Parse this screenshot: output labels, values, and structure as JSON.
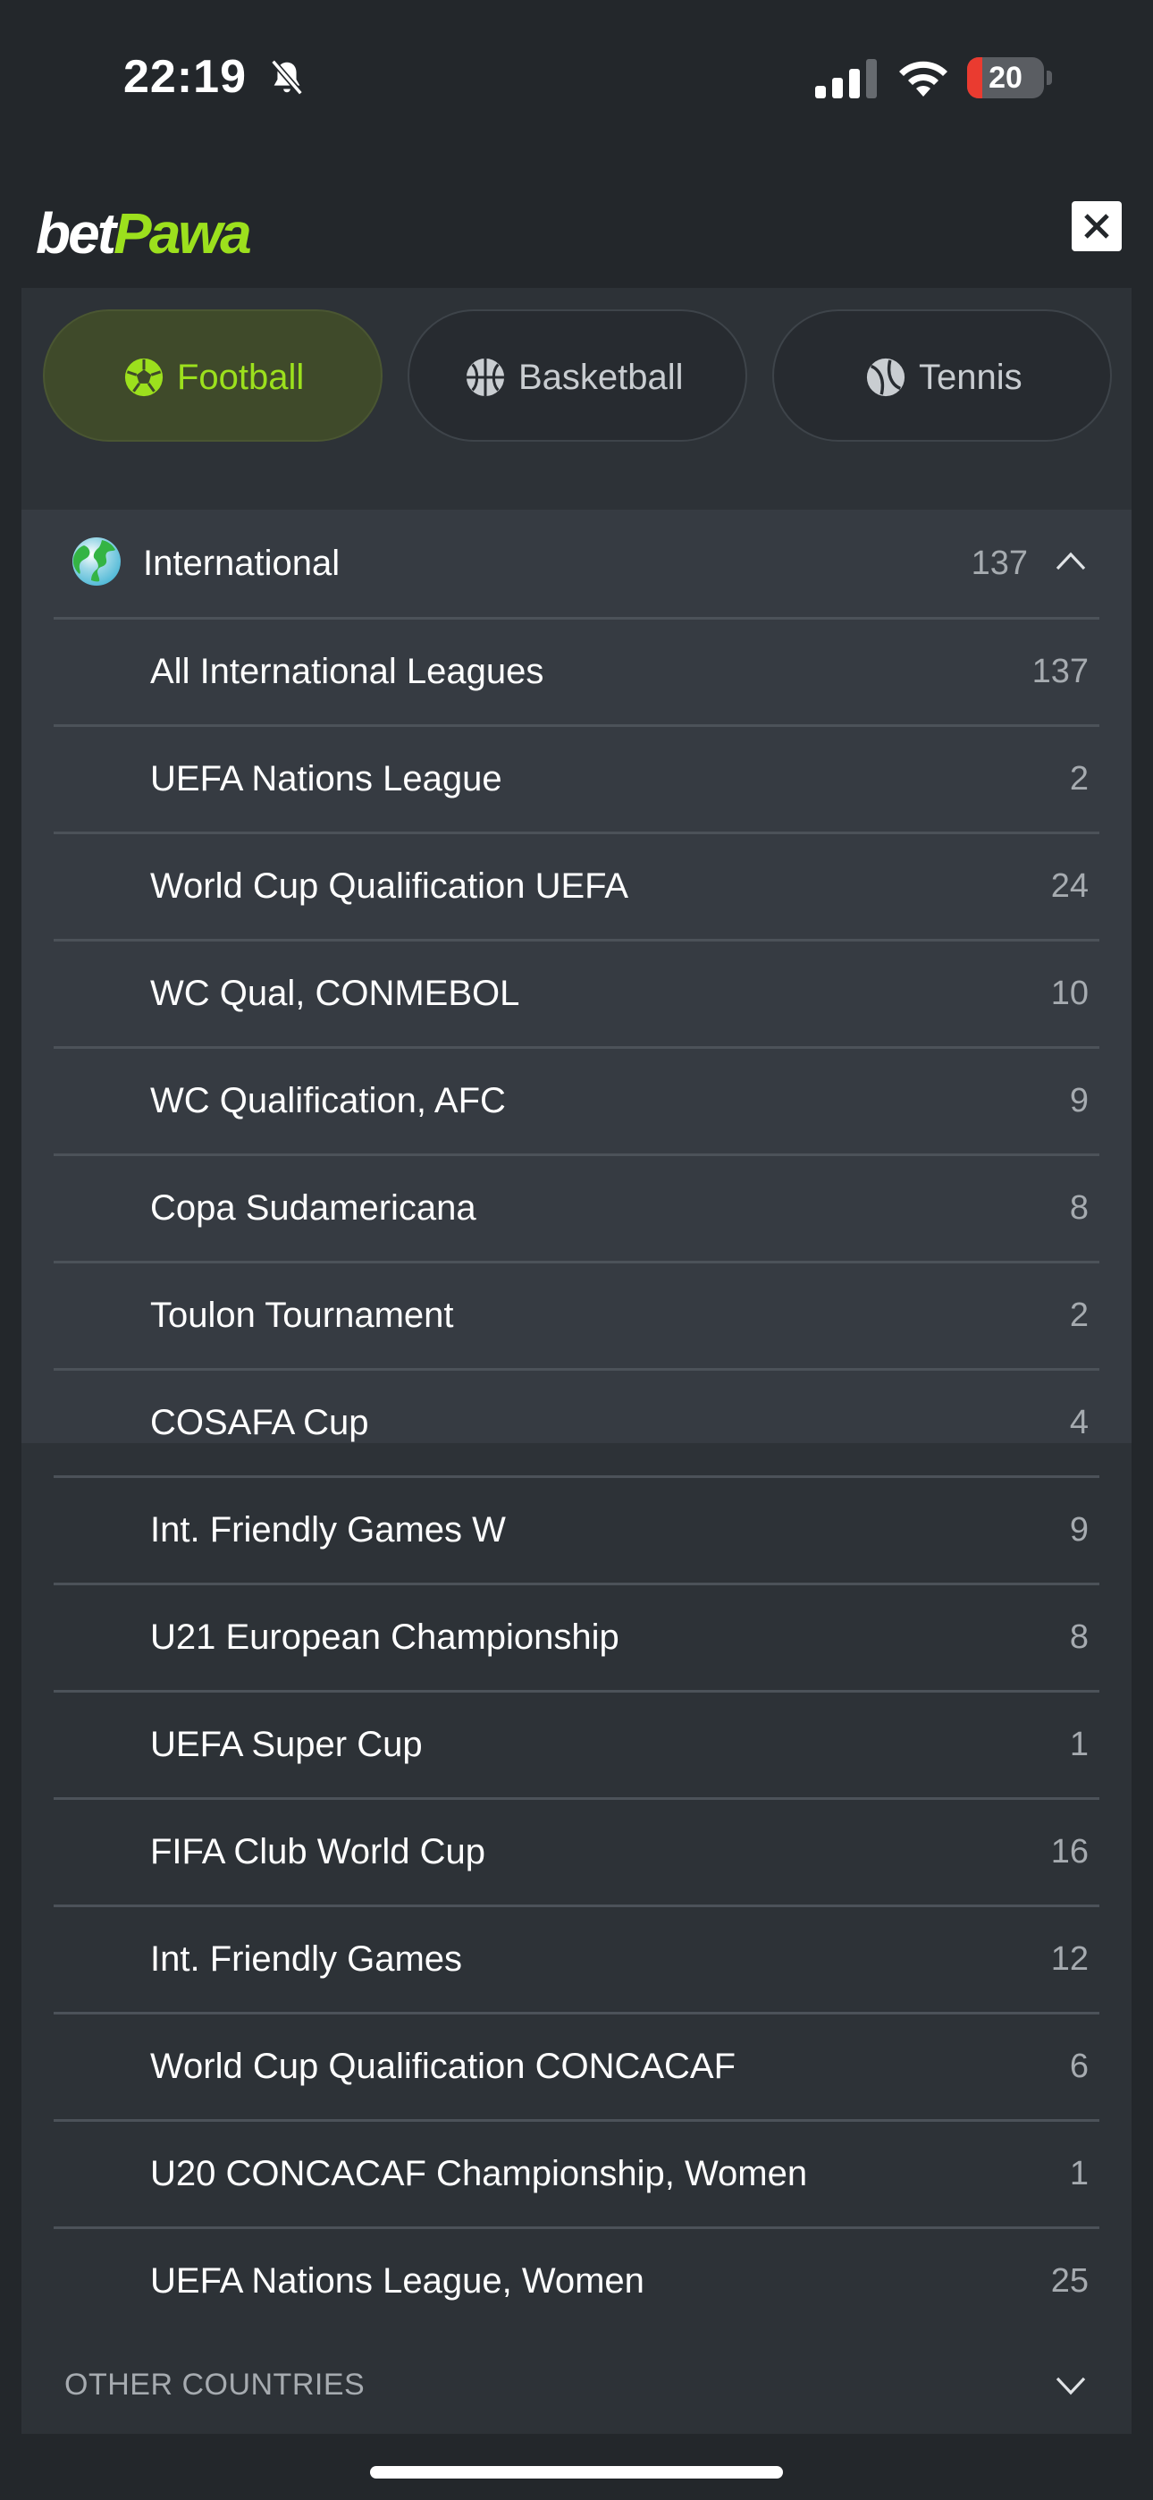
{
  "status_bar": {
    "time": "22:19",
    "battery_level": "20",
    "battery_fraction": 0.2,
    "icons": [
      "bell-slash-icon",
      "cellular-signal-icon",
      "wifi-icon",
      "battery-icon"
    ]
  },
  "header": {
    "logo_part1": "bet",
    "logo_part2": "Pawa",
    "close_icon": "close-icon"
  },
  "colors": {
    "brand_green": "#9ce01d",
    "background": "#23272b",
    "panel": "#2d3237",
    "group": "#363b42",
    "battery_red": "#ea3b30"
  },
  "sport_tabs": [
    {
      "label": "Football",
      "icon": "football-icon",
      "active": true
    },
    {
      "label": "Basketball",
      "icon": "basketball-icon",
      "active": false
    },
    {
      "label": "Tennis",
      "icon": "tennis-icon",
      "active": false
    }
  ],
  "group": {
    "title": "International",
    "count": "137",
    "icon": "globe-icon",
    "expanded": true,
    "leagues": [
      {
        "name": "All International Leagues",
        "count": "137"
      },
      {
        "name": "UEFA Nations League",
        "count": "2"
      },
      {
        "name": "World Cup Qualification UEFA",
        "count": "24"
      },
      {
        "name": "WC Qual, CONMEBOL",
        "count": "10"
      },
      {
        "name": "WC Qualification, AFC",
        "count": "9"
      },
      {
        "name": "Copa Sudamericana",
        "count": "8"
      },
      {
        "name": "Toulon Tournament",
        "count": "2"
      },
      {
        "name": "COSAFA Cup",
        "count": "4"
      },
      {
        "name": "Int. Friendly Games W",
        "count": "9"
      },
      {
        "name": "U21 European Championship",
        "count": "8"
      },
      {
        "name": "UEFA Super Cup",
        "count": "1"
      },
      {
        "name": "FIFA Club World Cup",
        "count": "16"
      },
      {
        "name": "Int. Friendly Games",
        "count": "12"
      },
      {
        "name": "World Cup Qualification CONCACAF",
        "count": "6"
      },
      {
        "name": "U20 CONCACAF Championship, Women",
        "count": "1"
      },
      {
        "name": "UEFA Nations League, Women",
        "count": "25"
      }
    ]
  },
  "other_countries": {
    "label": "OTHER COUNTRIES",
    "icon": "chevron-down-icon"
  }
}
